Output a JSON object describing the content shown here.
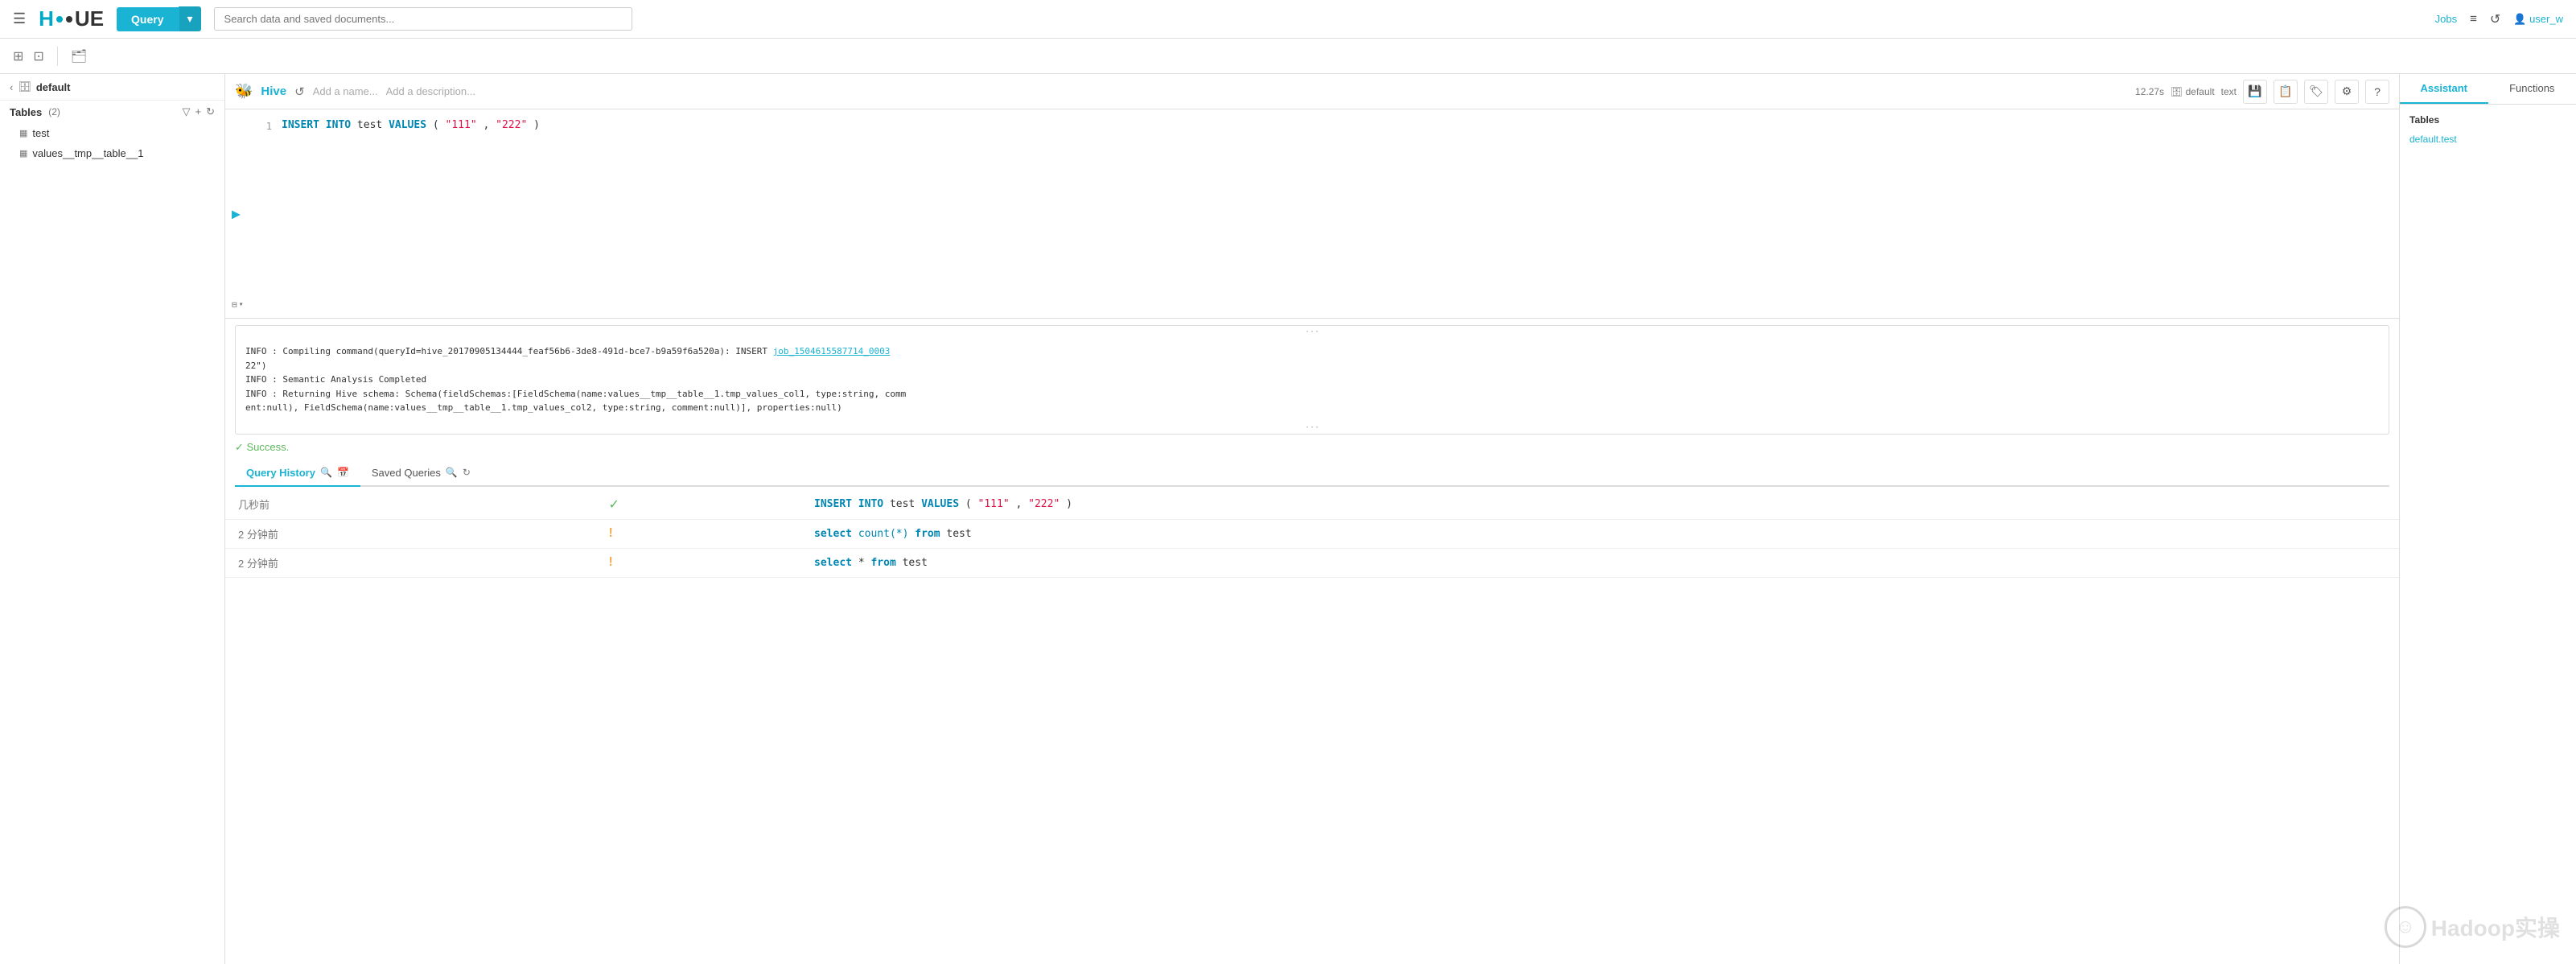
{
  "topnav": {
    "query_button": "Query",
    "search_placeholder": "Search data and saved documents...",
    "jobs_label": "Jobs",
    "user_label": "user_w"
  },
  "second_toolbar": {
    "icons": [
      "⊞",
      "⊡"
    ]
  },
  "left_sidebar": {
    "db_name": "default",
    "tables_label": "Tables",
    "tables_count": "(2)",
    "tables": [
      {
        "name": "test"
      },
      {
        "name": "values__tmp__table__1"
      }
    ]
  },
  "editor": {
    "hive_label": "Hive",
    "name_placeholder": "Add a name...",
    "desc_placeholder": "Add a description...",
    "meta_time": "12.27s",
    "meta_db": "default",
    "meta_type": "text",
    "code_lines": [
      {
        "number": "1",
        "parts": [
          {
            "type": "keyword",
            "text": "INSERT INTO"
          },
          {
            "type": "plain",
            "text": " test "
          },
          {
            "type": "keyword",
            "text": "VALUES"
          },
          {
            "type": "plain",
            "text": "("
          },
          {
            "type": "string",
            "text": "\"111\""
          },
          {
            "type": "plain",
            "text": ","
          },
          {
            "type": "string",
            "text": "\"222\""
          },
          {
            "type": "plain",
            "text": ")"
          }
        ]
      }
    ]
  },
  "log_output": {
    "line1": "INFO  : Compiling command(queryId=hive_20170905134444_feaf56b6-3de8-491d-bce7-b9a59f6a520a): INSERT ",
    "job_link": "job_1504615587714_0003",
    "line2": "22\")",
    "line3": "INFO  : Semantic Analysis Completed",
    "line4": "INFO  : Returning Hive schema: Schema(fieldSchemas:[FieldSchema(name:values__tmp__table__1.tmp_values_col1, type:string, comm",
    "line5": "ent:null), FieldSchema(name:values__tmp__table__1.tmp_values_col2, type:string, comment:null)], properties:null)"
  },
  "success": {
    "text": "✓  Success."
  },
  "result_tabs": [
    {
      "label": "Query History",
      "active": true,
      "icons": [
        "🔍",
        "📅"
      ]
    },
    {
      "label": "Saved Queries",
      "active": false,
      "icons": [
        "🔍",
        "↻"
      ]
    }
  ],
  "history_rows": [
    {
      "time": "几秒前",
      "status": "ok",
      "query_parts": [
        {
          "type": "keyword",
          "text": "INSERT INTO"
        },
        {
          "type": "plain",
          "text": " test "
        },
        {
          "type": "keyword",
          "text": "VALUES"
        },
        {
          "type": "plain",
          "text": "("
        },
        {
          "type": "string",
          "text": "\"111\""
        },
        {
          "type": "plain",
          "text": ","
        },
        {
          "type": "string",
          "text": "\"222\""
        },
        {
          "type": "plain",
          "text": ")"
        }
      ]
    },
    {
      "time": "2 分钟前",
      "status": "warn",
      "query_parts": [
        {
          "type": "keyword",
          "text": "select"
        },
        {
          "type": "plain",
          "text": " "
        },
        {
          "type": "fn",
          "text": "count(*)"
        },
        {
          "type": "plain",
          "text": " "
        },
        {
          "type": "keyword",
          "text": "from"
        },
        {
          "type": "plain",
          "text": " test"
        }
      ]
    },
    {
      "time": "2 分钟前",
      "status": "warn",
      "query_parts": [
        {
          "type": "keyword",
          "text": "select"
        },
        {
          "type": "plain",
          "text": " * "
        },
        {
          "type": "keyword",
          "text": "from"
        },
        {
          "type": "plain",
          "text": " test"
        }
      ]
    }
  ],
  "right_panel": {
    "tabs": [
      "Assistant",
      "Functions"
    ],
    "active_tab": "Assistant",
    "section_title": "Tables",
    "items": [
      "default.test"
    ]
  },
  "watermark": {
    "text": "Hadoop实操"
  }
}
